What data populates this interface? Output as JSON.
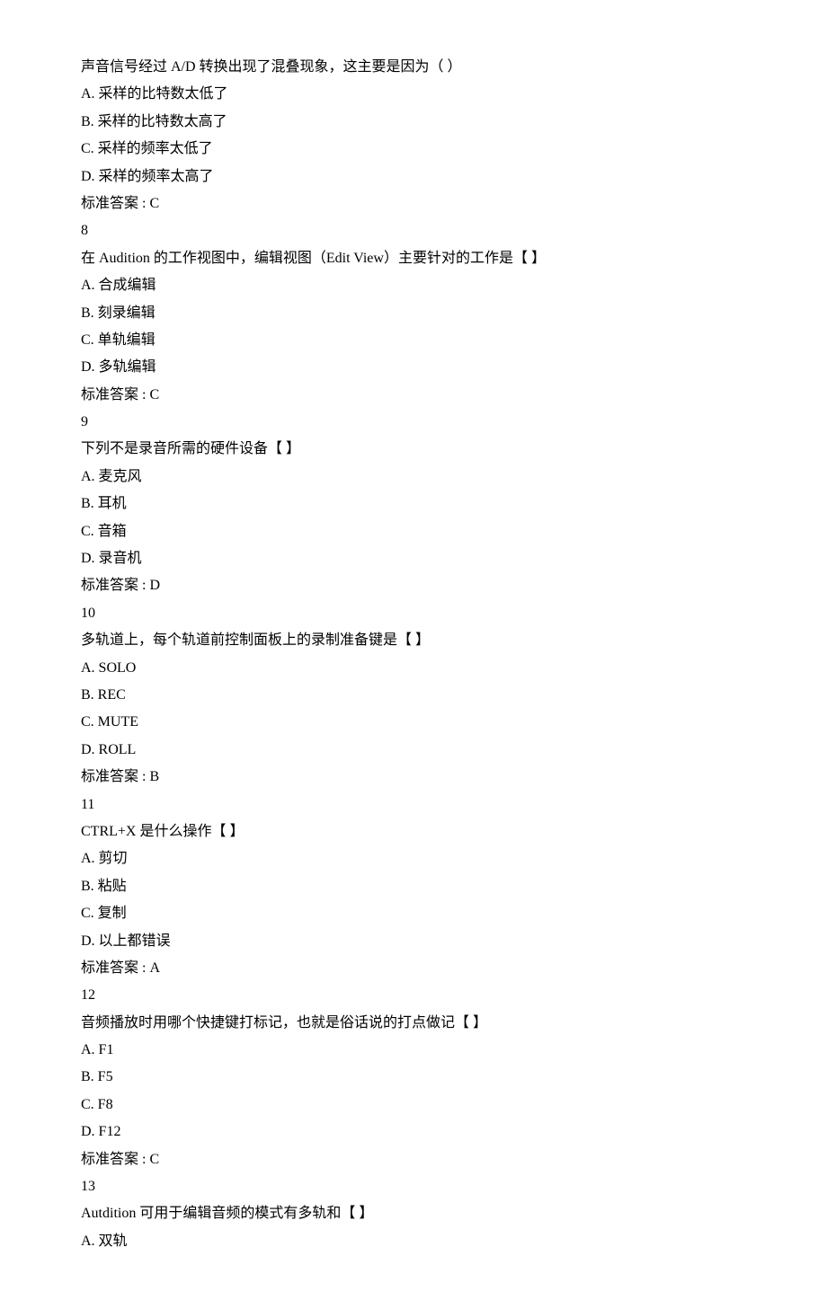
{
  "questions": [
    {
      "num": "",
      "stem": "声音信号经过 A/D 转换出现了混叠现象，这主要是因为（  ）",
      "options": [
        "A.    采样的比特数太低了",
        "B.    采样的比特数太高了",
        "C.    采样的频率太低了",
        "D.    采样的频率太高了"
      ],
      "answer": "标准答案 : C"
    },
    {
      "num": "8",
      "stem": "在 Audition 的工作视图中，编辑视图（Edit View）主要针对的工作是【  】",
      "options": [
        "A.    合成编辑",
        "B.    刻录编辑",
        "C.    单轨编辑",
        "D.    多轨编辑"
      ],
      "answer": "标准答案 : C"
    },
    {
      "num": "9",
      "stem": "下列不是录音所需的硬件设备【 】",
      "options": [
        "A.    麦克风",
        "B.    耳机",
        "C.    音箱",
        "D.    录音机"
      ],
      "answer": "标准答案 : D"
    },
    {
      "num": "10",
      "stem": "多轨道上，每个轨道前控制面板上的录制准备键是【 】",
      "options": [
        "A.    SOLO",
        "B.    REC",
        "C.    MUTE",
        "D.    ROLL"
      ],
      "answer": "标准答案 : B"
    },
    {
      "num": "11",
      "stem": "CTRL+X 是什么操作【 】",
      "options": [
        "A.    剪切",
        "B.    粘贴",
        "C.    复制",
        "D.    以上都错误"
      ],
      "answer": "标准答案 : A"
    },
    {
      "num": "12",
      "stem": "音频播放时用哪个快捷键打标记，也就是俗话说的打点做记【 】",
      "options": [
        "A.    F1",
        "B.    F5",
        "C.    F8",
        "D.    F12"
      ],
      "answer": "标准答案 : C"
    },
    {
      "num": "13",
      "stem": "Autdition 可用于编辑音频的模式有多轨和【 】",
      "options": [
        "A.    双轨"
      ],
      "answer": ""
    }
  ]
}
